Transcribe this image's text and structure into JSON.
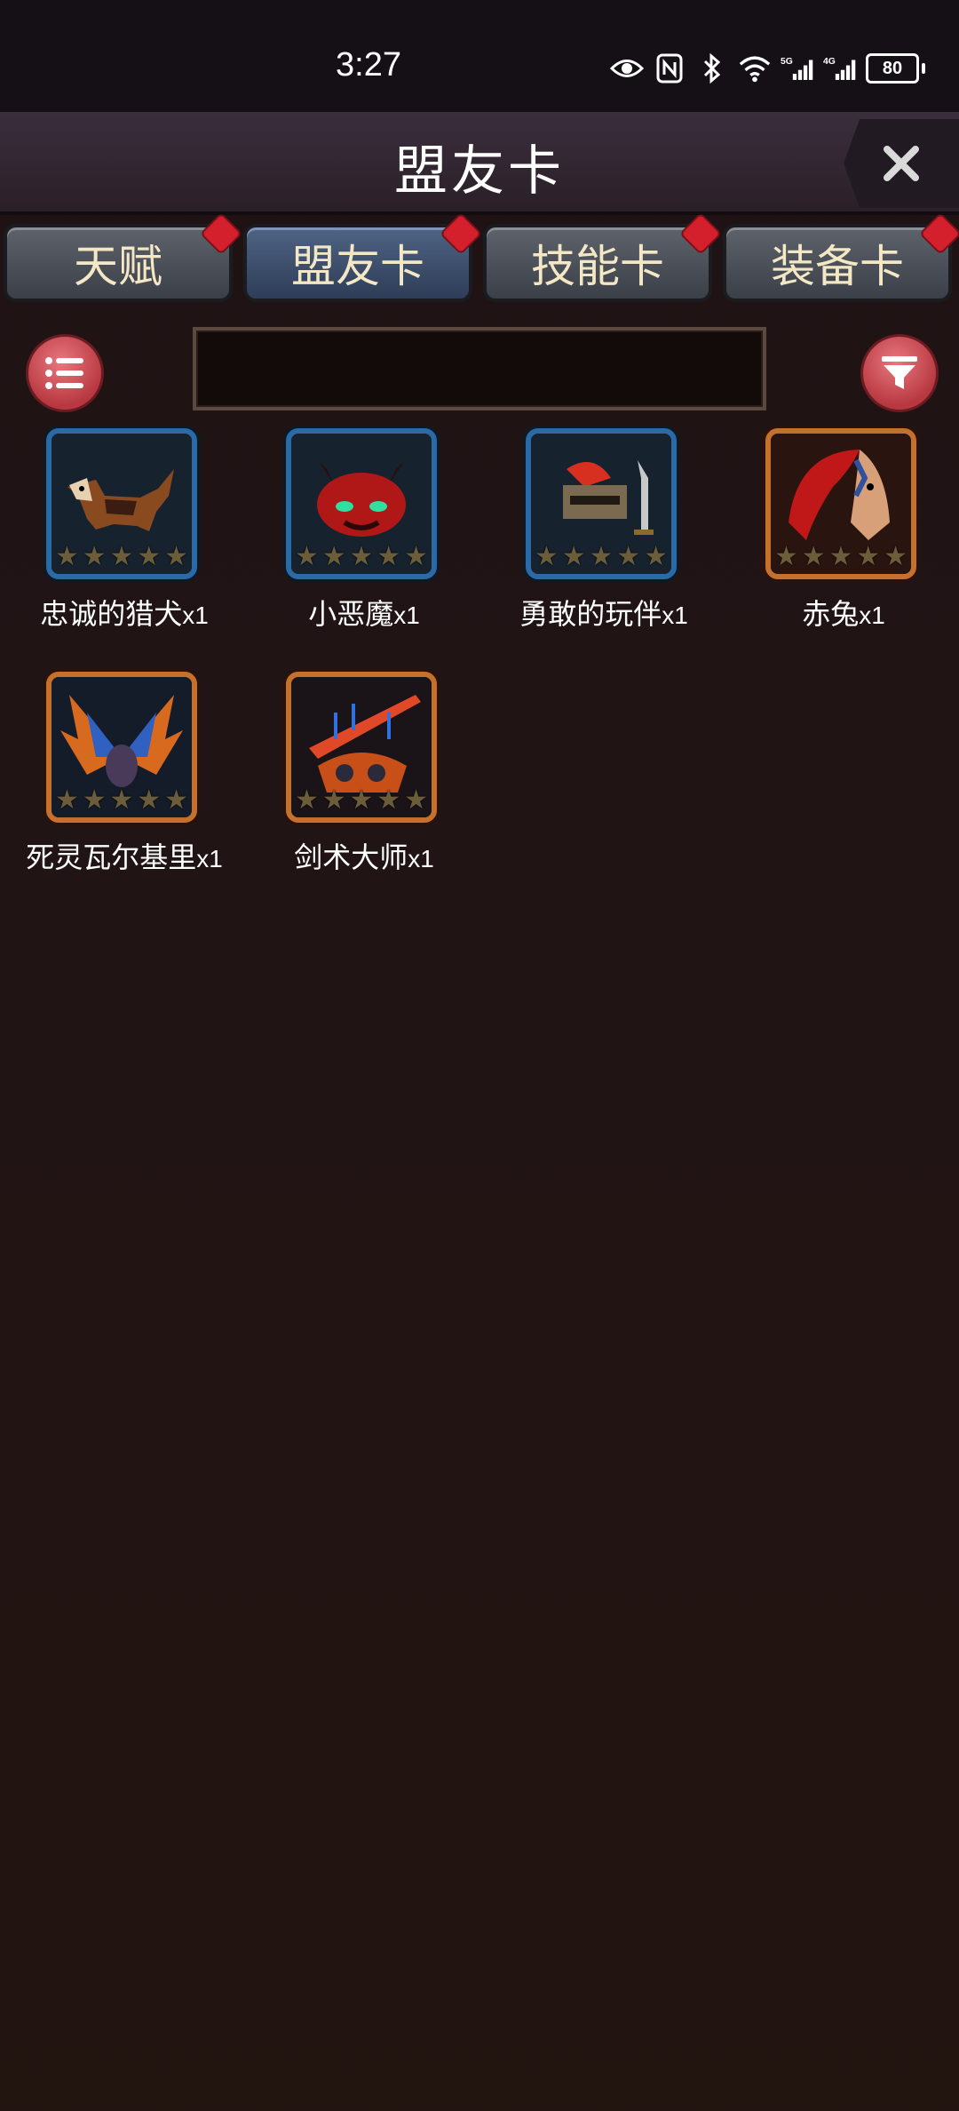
{
  "status_bar": {
    "time": "3:27",
    "battery": "80",
    "icons": [
      "eye-icon",
      "nfc-icon",
      "bluetooth-icon",
      "wifi-icon",
      "signal-5g-icon",
      "signal-4g-icon",
      "battery-icon"
    ]
  },
  "header": {
    "title": "盟友卡",
    "close_icon": "close-icon"
  },
  "tabs": [
    {
      "label": "天赋",
      "active": false,
      "badge": true
    },
    {
      "label": "盟友卡",
      "active": true,
      "badge": true
    },
    {
      "label": "技能卡",
      "active": false,
      "badge": true
    },
    {
      "label": "装备卡",
      "active": false,
      "badge": true
    }
  ],
  "toolbar": {
    "menu_icon": "list-icon",
    "search_value": "",
    "search_placeholder": "",
    "filter_icon": "filter-icon"
  },
  "cards": [
    {
      "name": "忠诚的猎犬",
      "qty": "x1",
      "frame": "blue",
      "art": "hound-art",
      "stars": 5
    },
    {
      "name": "小恶魔",
      "qty": "x1",
      "frame": "blue",
      "art": "imp-art",
      "stars": 5
    },
    {
      "name": "勇敢的玩伴",
      "qty": "x1",
      "frame": "blue",
      "art": "knight-art",
      "stars": 5
    },
    {
      "name": "赤兔",
      "qty": "x1",
      "frame": "orange",
      "art": "red-horse-art",
      "stars": 5
    },
    {
      "name": "死灵瓦尔基里",
      "qty": "x1",
      "frame": "orange",
      "art": "valkyrie-art",
      "stars": 5
    },
    {
      "name": "剑术大师",
      "qty": "x1",
      "frame": "orange",
      "art": "swordmaster-art",
      "stars": 5
    }
  ],
  "colors": {
    "background": "#211415",
    "header": "#322630",
    "tab_active": "#3e5170",
    "tab_inactive": "#4b5058",
    "tab_text": "#f3e7c6",
    "badge": "#d3202c",
    "round_button": "#c9464d",
    "frame_blue": "#2b6aa6",
    "frame_orange": "#c5712e"
  }
}
